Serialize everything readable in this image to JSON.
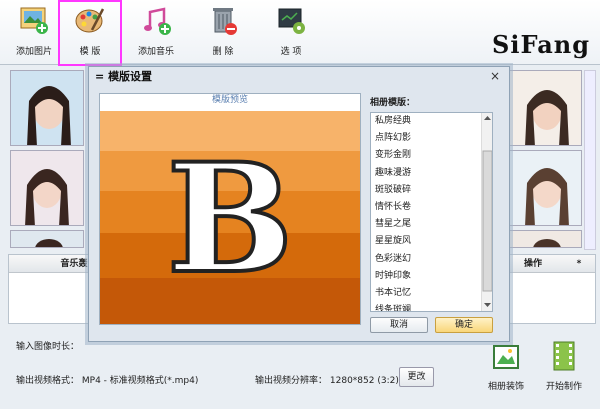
{
  "toolbar": {
    "add_image": "添加图片",
    "template": "模  版",
    "add_music": "添加音乐",
    "delete": "删 除",
    "options": "选 项"
  },
  "logo": "SiFang",
  "table": {
    "music_col": "音乐轰",
    "ops_col": "操作",
    "star_col": "*"
  },
  "bottom": {
    "input_duration_label": "输入图像时长：",
    "output_format_label": "输出视频格式：",
    "output_format_value": "MP4 - 标准视频格式(*.mp4)",
    "resolution_label": "输出视频分辨率：",
    "resolution_value": "1280*852 (3:2)",
    "change_button": "更改",
    "decorate_button": "相册装饰",
    "start_button": "开始制作"
  },
  "dialog": {
    "title": "模版设置",
    "preview_header": "模版预览",
    "preview_letter": "B",
    "album_label": "相册模版：",
    "album_items": [
      "私房经典",
      "点阵幻影",
      "变形金刚",
      "趣味漫游",
      "斑驳破碎",
      "情怀长卷",
      "彗星之尾",
      "星星旋风",
      "色彩迷幻",
      "时钟印象",
      "书本记忆",
      "线条斑斓"
    ],
    "cancel": "取消",
    "ok": "确定",
    "close": "×"
  },
  "colors": {
    "accent_highlight": "#ff37ff",
    "stripe_1": "#f7b36a",
    "stripe_2": "#ef9a40",
    "stripe_3": "#e58320",
    "stripe_4": "#d46a0b",
    "stripe_5": "#c45808",
    "ok_button": "#fde7a6"
  }
}
